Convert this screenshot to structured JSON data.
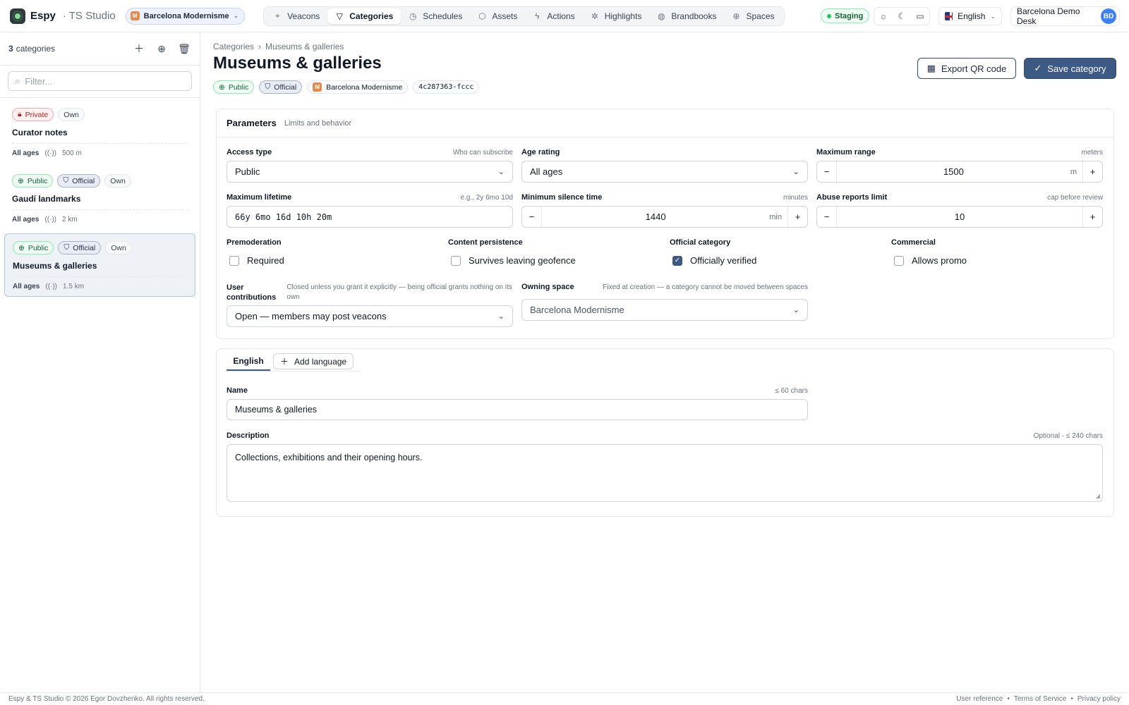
{
  "topbar": {
    "brand": "Espy",
    "studio": "· TS Studio",
    "space_avatar": "M",
    "space_name": "Barcelona Modernisme",
    "nav": [
      {
        "label": "Veacons",
        "icon": "pin-icon"
      },
      {
        "label": "Categories",
        "icon": "filter-icon",
        "active": true
      },
      {
        "label": "Schedules",
        "icon": "clock-icon"
      },
      {
        "label": "Assets",
        "icon": "box-icon"
      },
      {
        "label": "Actions",
        "icon": "bolt-icon"
      },
      {
        "label": "Highlights",
        "icon": "sparkle-icon"
      },
      {
        "label": "Brandbooks",
        "icon": "palette-icon"
      },
      {
        "label": "Spaces",
        "icon": "globe-icon"
      }
    ],
    "env_badge": "Staging",
    "language": "English",
    "user_name": "Barcelona Demo Desk",
    "user_initials": "BD"
  },
  "sidebar": {
    "count": "3",
    "count_label": "categories",
    "filter_placeholder": "Filter...",
    "items": [
      {
        "visibility": "Private",
        "official": null,
        "own": "Own",
        "title": "Curator notes",
        "age": "All ages",
        "range": "500 m"
      },
      {
        "visibility": "Public",
        "official": "Official",
        "own": "Own",
        "title": "Gaudí landmarks",
        "age": "All ages",
        "range": "2 km"
      },
      {
        "visibility": "Public",
        "official": "Official",
        "own": "Own",
        "title": "Museums & galleries",
        "age": "All ages",
        "range": "1.5 km",
        "selected": true
      }
    ]
  },
  "header": {
    "breadcrumb_root": "Categories",
    "breadcrumb_current": "Museums & galleries",
    "title": "Museums & galleries",
    "badge_visibility": "Public",
    "badge_official": "Official",
    "space_avatar": "M",
    "space_name": "Barcelona Modernisme",
    "id": "4c287363-fccc",
    "export_label": "Export QR code",
    "save_label": "Save category"
  },
  "params": {
    "title": "Parameters",
    "subtitle": "Limits and behavior",
    "access_type": {
      "label": "Access type",
      "hint": "Who can subscribe",
      "value": "Public"
    },
    "age_rating": {
      "label": "Age rating",
      "value": "All ages"
    },
    "max_range": {
      "label": "Maximum range",
      "hint": "meters",
      "value": "1500",
      "unit": "m"
    },
    "max_lifetime": {
      "label": "Maximum lifetime",
      "hint": "e.g., 2y 6mo 10d",
      "value": "66y 6mo 16d 10h 20m"
    },
    "min_silence": {
      "label": "Minimum silence time",
      "hint": "minutes",
      "value": "1440",
      "unit": "min"
    },
    "abuse_limit": {
      "label": "Abuse reports limit",
      "hint": "cap before review",
      "value": "10"
    },
    "premoderation": {
      "label": "Premoderation",
      "option": "Required",
      "checked": false
    },
    "persistence": {
      "label": "Content persistence",
      "option": "Survives leaving geofence",
      "checked": false
    },
    "official": {
      "label": "Official category",
      "option": "Officially verified",
      "checked": true
    },
    "commercial": {
      "label": "Commercial",
      "option": "Allows promo",
      "checked": false
    },
    "contributions": {
      "label_1": "User",
      "label_2": "contributions",
      "hint": "Closed unless you grant it explicitly — being official grants nothing on its own",
      "value": "Open — members may post veacons"
    },
    "owning_space": {
      "label": "Owning space",
      "hint": "Fixed at creation — a category cannot be moved between spaces",
      "value": "Barcelona Modernisme"
    }
  },
  "locale": {
    "tab_english": "English",
    "add_language": "Add language",
    "name_label": "Name",
    "name_hint": "≤ 60 chars",
    "name_value": "Museums & galleries",
    "desc_label": "Description",
    "desc_hint": "Optional · ≤ 240 chars",
    "desc_value": "Collections, exhibitions and their opening hours."
  },
  "footer": {
    "copyright": "Espy & TS Studio © 2026 Egor Dovzhenko. All rights reserved.",
    "link_reference": "User reference",
    "link_terms": "Terms of Service",
    "link_privacy": "Privacy policy",
    "sep": "•"
  }
}
